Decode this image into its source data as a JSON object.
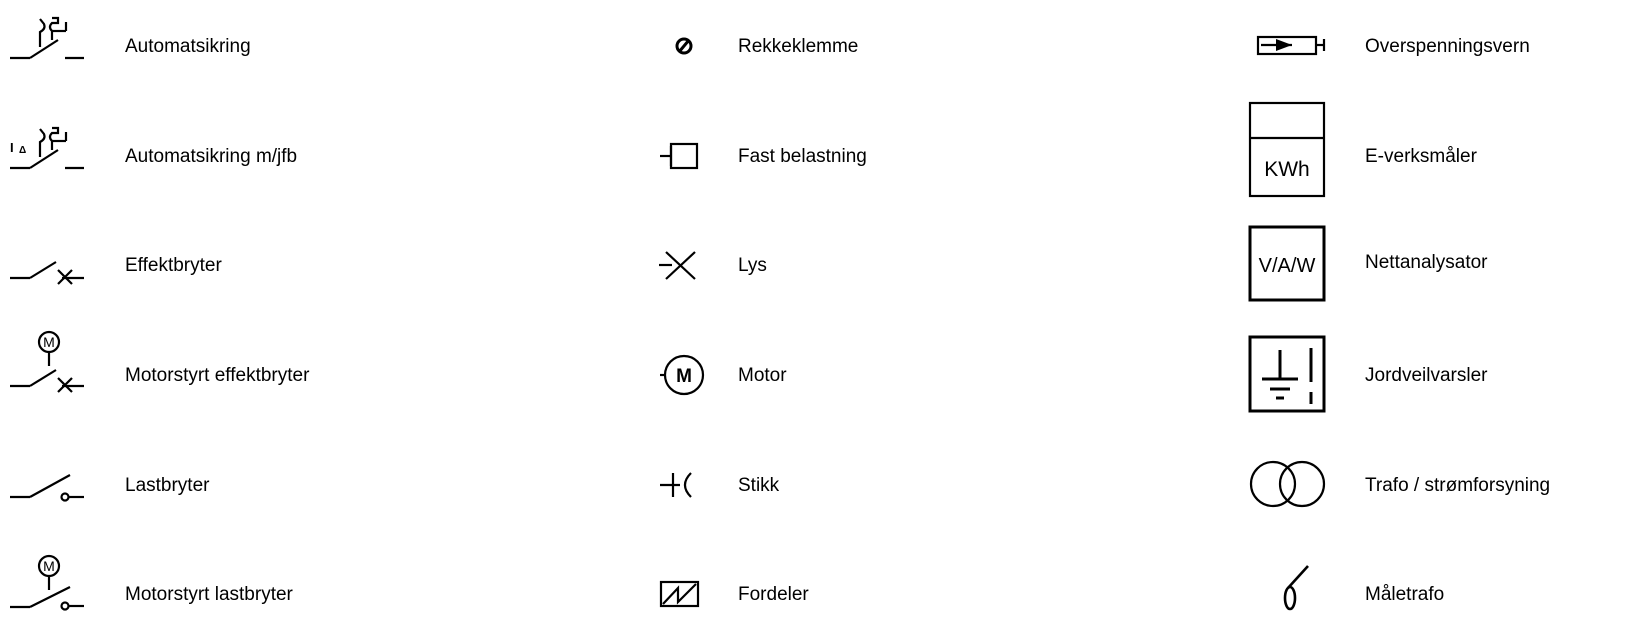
{
  "legend": {
    "col1": [
      {
        "label": "Automatsikring",
        "icon": "automatic-fuse-icon"
      },
      {
        "label": "Automatsikring m/jfb",
        "icon": "automatic-fuse-rcd-icon"
      },
      {
        "label": "Effektbryter",
        "icon": "circuit-breaker-icon"
      },
      {
        "label": "Motorstyrt effektbryter",
        "icon": "motorized-circuit-breaker-icon"
      },
      {
        "label": "Lastbryter",
        "icon": "load-switch-icon"
      },
      {
        "label": "Motorstyrt lastbryter",
        "icon": "motorized-load-switch-icon"
      }
    ],
    "col2": [
      {
        "label": "Rekkeklemme",
        "icon": "terminal-block-icon"
      },
      {
        "label": "Fast belastning",
        "icon": "fixed-load-icon"
      },
      {
        "label": "Lys",
        "icon": "light-icon"
      },
      {
        "label": "Motor",
        "icon": "motor-icon"
      },
      {
        "label": "Stikk",
        "icon": "socket-icon"
      },
      {
        "label": "Fordeler",
        "icon": "distributor-icon"
      }
    ],
    "col3": [
      {
        "label": "Overspenningsvern",
        "icon": "surge-protector-icon"
      },
      {
        "label": "E-verksmåler",
        "icon": "energy-meter-icon"
      },
      {
        "label": "Nettanalysator",
        "icon": "network-analyzer-icon"
      },
      {
        "label": "Jordveilvarsler",
        "icon": "earth-fault-indicator-icon"
      },
      {
        "label": "Trafo / strømforsyning",
        "icon": "transformer-icon"
      },
      {
        "label": "Måletrafo",
        "icon": "measuring-transformer-icon"
      }
    ]
  },
  "symbol_text": {
    "rcd_mark": "I",
    "rcd_sub": "Δ",
    "motor_mark": "M",
    "meter_unit": "KWh",
    "analyzer_text": "V/A/W"
  }
}
